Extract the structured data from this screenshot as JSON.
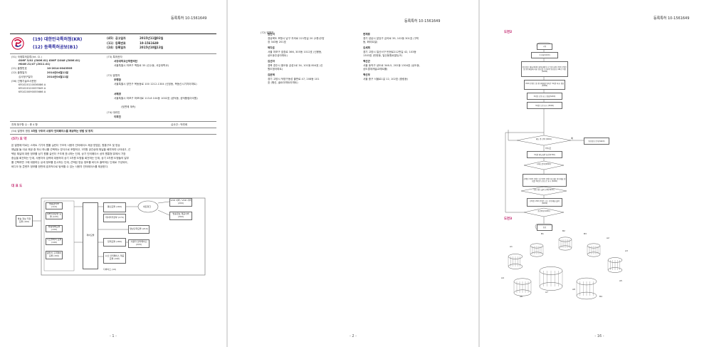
{
  "header": {
    "doc_number": "등록특허 10-1561649"
  },
  "page1": {
    "office_no": "(19)",
    "office": "대한민국특허청(KR)",
    "pubtype_no": "(12)",
    "pubtype": "등록특허공보(B1)",
    "bib": [
      {
        "code": "(45)",
        "label": "공고일자",
        "value": "2015년11월02일"
      },
      {
        "code": "(11)",
        "label": "등록번호",
        "value": "10-1561649"
      },
      {
        "code": "(24)",
        "label": "등록일자",
        "value": "2015년10월13일"
      }
    ],
    "ipc_title": "(51) 국제특허분류(Int. Cl.)",
    "ipc": [
      "G06F 3/01 (2006.01) G06F 3/048 (2006.01)",
      "H04N 21/47 (2011.01)"
    ],
    "app_no_label": "(21) 출원번호",
    "app_no": "10-2014-0043505",
    "app_date_label": "(22) 출원일자",
    "app_date": "2014년04월11일",
    "exam_label": "심사청구일자",
    "exam_date": "2014년04월11일",
    "prior_title": "(56) 선행기술조사문헌",
    "prior": [
      "KR1020110036086 A",
      "KR1020120037849 A",
      "KR1020090055666 A"
    ],
    "owner_title": "(73) 특허권자",
    "owner_name": "서강대학교산학협력단",
    "owner_addr": "서울특별시 마포구 백범로 35 (신수동, 서강대학교)",
    "inventor_title": "(72) 발명자",
    "inv1_name": "우행환",
    "inv1_addr": "서울특별시 양천구 목동동로 100 1212-1304 (신정동, 목동신시가지아파트)",
    "inv2_name": "서혜경",
    "inv2_addr": "서울특별시 마포구 마포대로 113-8 104동 1002호 (공덕동, 공덕풍림아이원)",
    "inv_more": "(뒷면에 계속)",
    "agent_title": "(74) 대리인",
    "agent": "이희진",
    "claims_left": "전체 청구항 수 : 총 4 항",
    "examiner": "심사관 : 박민희",
    "title_label": "(54) 발명의 명칭",
    "title": "3차원 구조의 사용자 인터페이스를 제공하는 방법 및 장치",
    "abstract_heading": "(57) 요 약",
    "abstract": [
      "본 발명에 따르는 스마트 기기의 원뿔 실린더 구조의 사용자 인터페이스 제공 방법은, 원통구조 및 방송",
      "채널을 둘 이상 제공 중 하나 하나를 선택하는 방식으로 포함하고, 3차원 공간상에 채널을 배치하여 나타내고, 선",
      "택된 채널에 대한 정보를 상기 원뿔 실린더 구조에 표시하는 단계, 상기 인터페이스 상의 원통형 뷰에서 가장",
      "중심을 회전하는 단계, 사용자의 입력에 대응하여 상기 3차원 도형을 회전하는 단계, 상기 3차원 도형들의 일부",
      "를 선택하면 그에 대응하는 상세 정보를 표시하는 단계, 선택된 방송 정보를 비디오 출력하는 단계로 구성되어,",
      "비디오 등 콘텐츠 정보를 한번에 효과적으로 탐색할 수 있는 사용자 인터페이스를 제공한다."
    ],
    "rep_fig": "대 표 도",
    "fig_left_label": "방송 정보 저장 모듈 (100)",
    "fig_boxes": [
      "방송관리부 (110)",
      "대부지정관련 모듈 (120)",
      "방송목록모듈 (130)",
      "디스플레이 모듈 (140)",
      "원터치 출력제어모듈 (150)"
    ],
    "fig_center": "제어모듈",
    "fig_right_boxes": [
      "통신모듈 (160)",
      "데이터저장부 (170)",
      "입력모듈 (180)",
      "수신 인터페이스 제공 모듈 (190)"
    ],
    "fig_far": [
      "VOD 서버 / VOD 서버 (200)",
      "방송정보 제공서버 (300)",
      "영상출력모듈 (210)",
      "사용자 인터페이스 (220)"
    ],
    "fig_cloud": "네트워크",
    "fig_bottom": "디바이스 (10)",
    "page_number": "- 1 -"
  },
  "page2": {
    "cont_title": "(72) 발명자",
    "left": [
      {
        "name": "권진석",
        "addr": [
          "경상북도 포항시 남구 자곡로 221번길 20 (2층)주방",
          "장 343동 201호"
        ]
      },
      {
        "name": "박다은",
        "addr": [
          "서울 마포구 효창로 366, 305동 1012호 (신봉동,",
          "상도동주공아파트)"
        ]
      },
      {
        "name": "김선아",
        "addr": [
          "경북 경주시 황오동 금성1로 34, 101동 804호 (신",
          "원도청아파트)"
        ]
      },
      {
        "name": "김준혁",
        "addr": [
          "경기 고양시 덕양구동성 출판로 47, 208동 101",
          "호 (행신, 솔트아파트아파트)"
        ]
      }
    ],
    "right": [
      {
        "name": "변재용",
        "addr": [
          "경기 성남시 분당구 금곡로 39, 102동 301호 (구미",
          "동, 화이트빌)"
        ]
      },
      {
        "name": "김세희",
        "addr": [
          "경기 고양시 일산서구 탄현로212번길 42, 103동",
          "1303호 (탄현동, 일산동원로얄듀크)"
        ]
      },
      {
        "name": "백선근",
        "addr": [
          "서울 동작구 상도로 346-5, 202동 1304호 (상도동,",
          "상도롯데캐슬교래트를)"
        ]
      },
      {
        "name": "백선우",
        "addr": [
          "서울 중구 서울로1길 12, 102호 (중림동)"
        ]
      }
    ],
    "page_number": "- 2 -"
  },
  "page3": {
    "fig2_title": "도면2",
    "flow": [
      "시작",
      "초기화(S100)",
      "방송정보 채널서버의 데이터베이스로 접속하여 VOD 콘텐츠 및 방송채널에 대한 정보를 수신하여 방송정보 DB로 저장(S200)",
      "VOD 콘텐츠 및 방송채널별 위치간 3차원 좌표 생성(S300)",
      "3차원 도형 요소 생성(S400)",
      "3차원 도형 표시 (S500)",
      "메뉴 중 선택 (S610)",
      "방송정보 분석(S620)",
      "3차원 메뉴화면 회전(S700)",
      "키패드입력(S800)",
      "선택된 VOD 콘텐츠 및 VOD 콘텐츠에 대한 방송채널 정보를 3차원 도형으로 표시 (S900)",
      "방송 정보 출력 선택(S920)",
      "선택된 VOD 콘텐츠 또는 방송채널 출력(S930)",
      "종료여부(S950)",
      "종료"
    ],
    "flow_yes": "예",
    "flow_no": "아니오",
    "fig3_title": "도면3",
    "fig3_labels": [
      "B1",
      "B2",
      "B3",
      "A1",
      "A2",
      "A3",
      "A4",
      "A5",
      "A6",
      "A7",
      "A8",
      "B4"
    ],
    "page_number": "- 16 -"
  }
}
